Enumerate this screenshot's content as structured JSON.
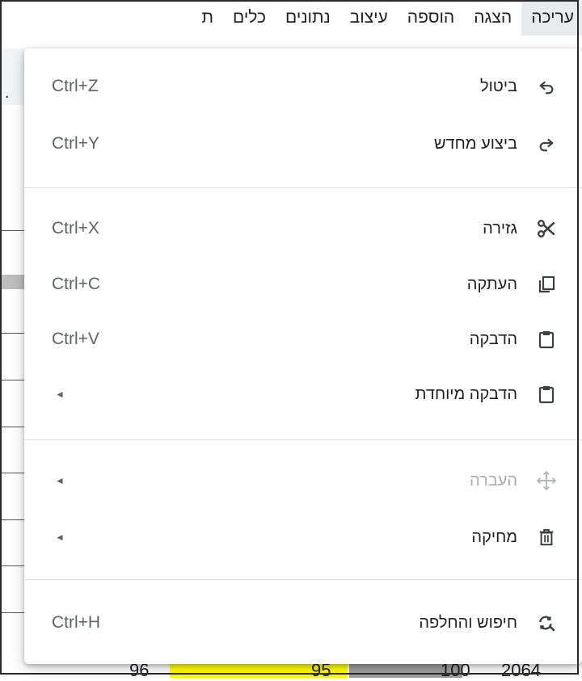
{
  "menubar": {
    "items": [
      "עריכה",
      "הצגה",
      "הוספה",
      "עיצוב",
      "נתונים",
      "כלים",
      "ת"
    ]
  },
  "sheet": {
    "bottom_values": [
      "96",
      "95",
      "100",
      "2064"
    ]
  },
  "menu": {
    "undo": {
      "label": "ביטול",
      "shortcut": "Ctrl+Z",
      "icon": "undo-icon"
    },
    "redo": {
      "label": "ביצוע מחדש",
      "shortcut": "Ctrl+Y",
      "icon": "redo-icon"
    },
    "cut": {
      "label": "גזירה",
      "shortcut": "Ctrl+X",
      "icon": "scissors-icon"
    },
    "copy": {
      "label": "העתקה",
      "shortcut": "Ctrl+C",
      "icon": "copy-icon"
    },
    "paste": {
      "label": "הדבקה",
      "shortcut": "Ctrl+V",
      "icon": "clipboard-icon"
    },
    "paste_special": {
      "label": "הדבקה מיוחדת",
      "submenu_arrow": "◄",
      "icon": "clipboard-icon"
    },
    "move": {
      "label": "העברה",
      "submenu_arrow": "◄",
      "icon": "move-icon",
      "disabled": true
    },
    "delete": {
      "label": "מחיקה",
      "submenu_arrow": "◄",
      "icon": "trash-icon"
    },
    "find_replace": {
      "label": "חיפוש והחלפה",
      "shortcut": "Ctrl+H",
      "icon": "find-replace-icon"
    }
  },
  "colors": {
    "menubar_active_bg": "#e8eaed",
    "yellow_cell": "#ffff00",
    "gray_cell": "#9e9e9e",
    "disabled_text": "#a8abaf"
  }
}
